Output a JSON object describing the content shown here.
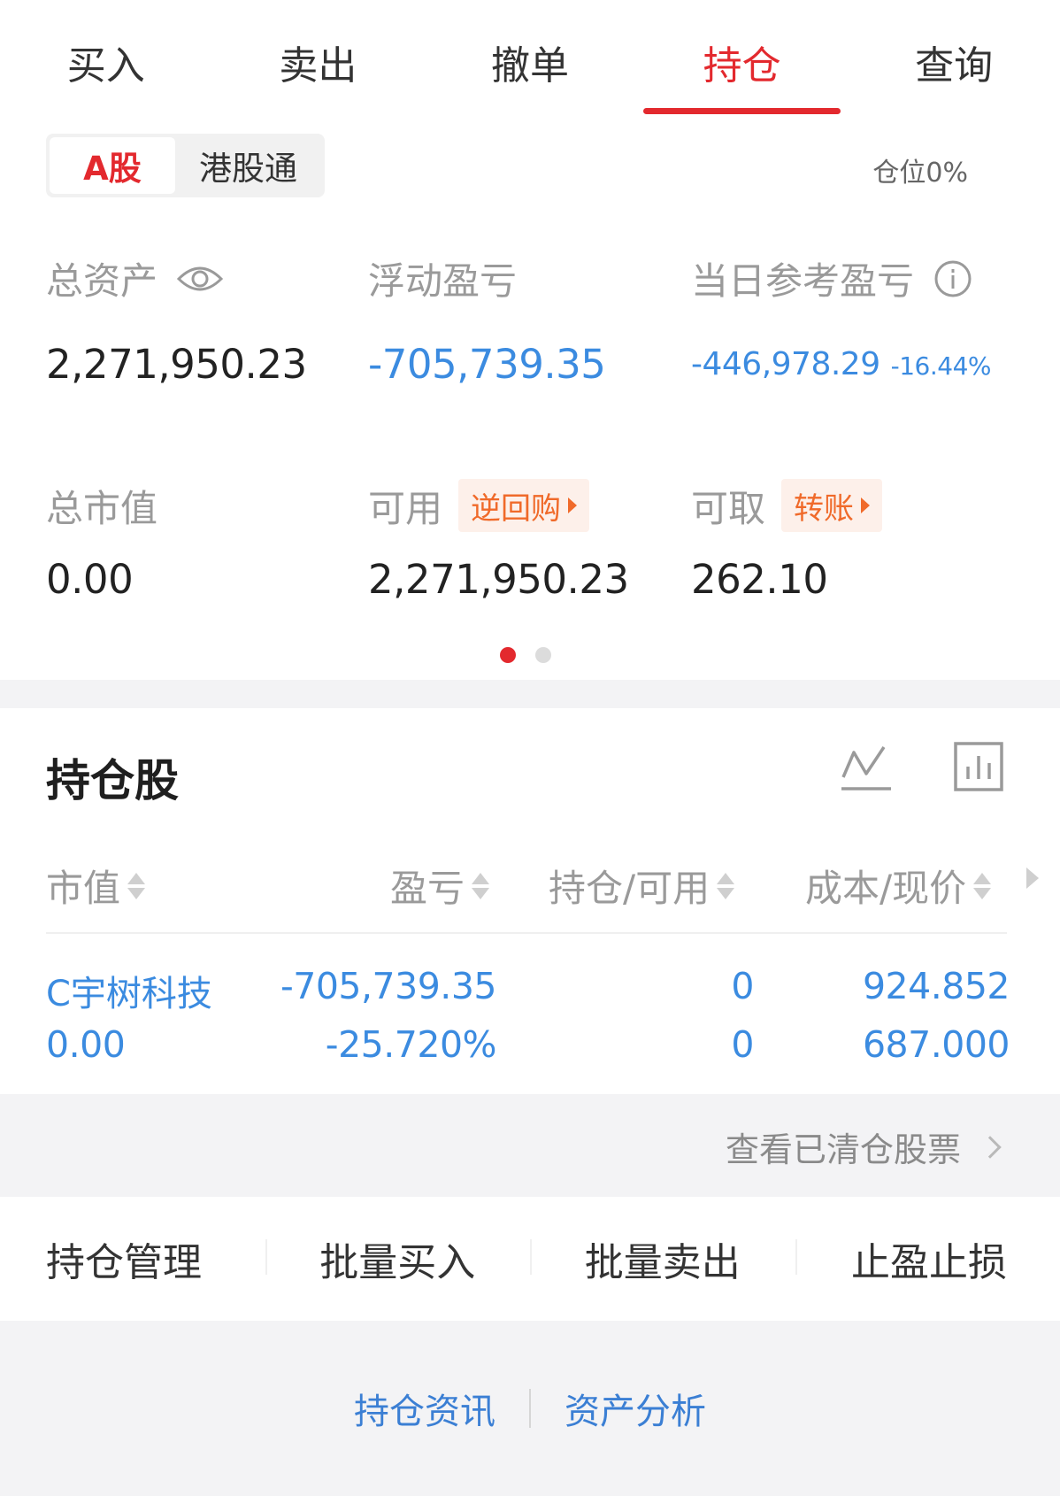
{
  "tabs": [
    {
      "label": "买入"
    },
    {
      "label": "卖出"
    },
    {
      "label": "撤单"
    },
    {
      "label": "持仓"
    },
    {
      "label": "查询"
    }
  ],
  "active_tab": "持仓",
  "market": {
    "a_share": "A股",
    "hk_connect": "港股通",
    "position_label": "仓位0%"
  },
  "summary": {
    "total_assets_label": "总资产",
    "total_assets_value": "2,271,950.23",
    "floating_pl_label": "浮动盈亏",
    "floating_pl_value": "-705,739.35",
    "daily_pl_label": "当日参考盈亏",
    "daily_pl_value": "-446,978.29",
    "daily_pl_pct": "-16.44%",
    "market_value_label": "总市值",
    "market_value_value": "0.00",
    "available_label": "可用",
    "available_chip": "逆回购",
    "available_value": "2,271,950.23",
    "withdrawable_label": "可取",
    "withdrawable_chip": "转账",
    "withdrawable_value": "262.10"
  },
  "pager": {
    "count": 2,
    "active": 0
  },
  "holdings": {
    "title": "持仓股",
    "columns": {
      "market_value": "市值",
      "pl": "盈亏",
      "position": "持仓/可用",
      "cost_price": "成本/现价"
    },
    "rows": [
      {
        "name": "C宇树科技",
        "market_value": "0.00",
        "pl": "-705,739.35",
        "pl_pct": "-25.720%",
        "position": "0",
        "available": "0",
        "cost": "924.852",
        "price": "687.000"
      }
    ],
    "cleared_link": "查看已清仓股票"
  },
  "actions": [
    {
      "label": "持仓管理"
    },
    {
      "label": "批量买入"
    },
    {
      "label": "批量卖出"
    },
    {
      "label": "止盈止损"
    }
  ],
  "footer": {
    "news": "持仓资讯",
    "analysis": "资产分析"
  },
  "colors": {
    "accent_red": "#e3292e",
    "loss_blue": "#3b8be0",
    "chip_orange": "#f06a2a"
  }
}
